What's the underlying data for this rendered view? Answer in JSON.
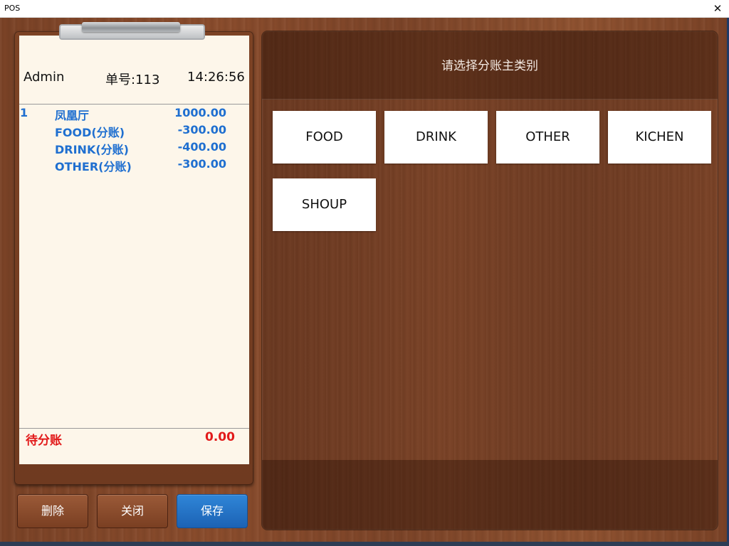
{
  "window": {
    "title": "POS",
    "close_glyph": "✕"
  },
  "receipt": {
    "user": "Admin",
    "order_no": "单号:113",
    "time": "14:26:56",
    "lines": [
      {
        "no": "1",
        "name": "凤凰厅",
        "amount": "1000.00"
      },
      {
        "no": "",
        "name": "FOOD(分账)",
        "amount": "-300.00"
      },
      {
        "no": "",
        "name": "DRINK(分账)",
        "amount": "-400.00"
      },
      {
        "no": "",
        "name": "OTHER(分账)",
        "amount": "-300.00"
      }
    ],
    "pending_label": "待分账",
    "pending_amount": "0.00"
  },
  "buttons": {
    "delete": "删除",
    "close": "关闭",
    "save": "保存"
  },
  "categories": {
    "title": "请选择分账主类别",
    "items": [
      "FOOD",
      "DRINK",
      "OTHER",
      "KICHEN",
      "SHOUP"
    ]
  },
  "colors": {
    "accent_blue": "#1f6fd0",
    "pending_red": "#e21a1a",
    "save_button": "#2f86d8",
    "wood": "#7a4226"
  }
}
